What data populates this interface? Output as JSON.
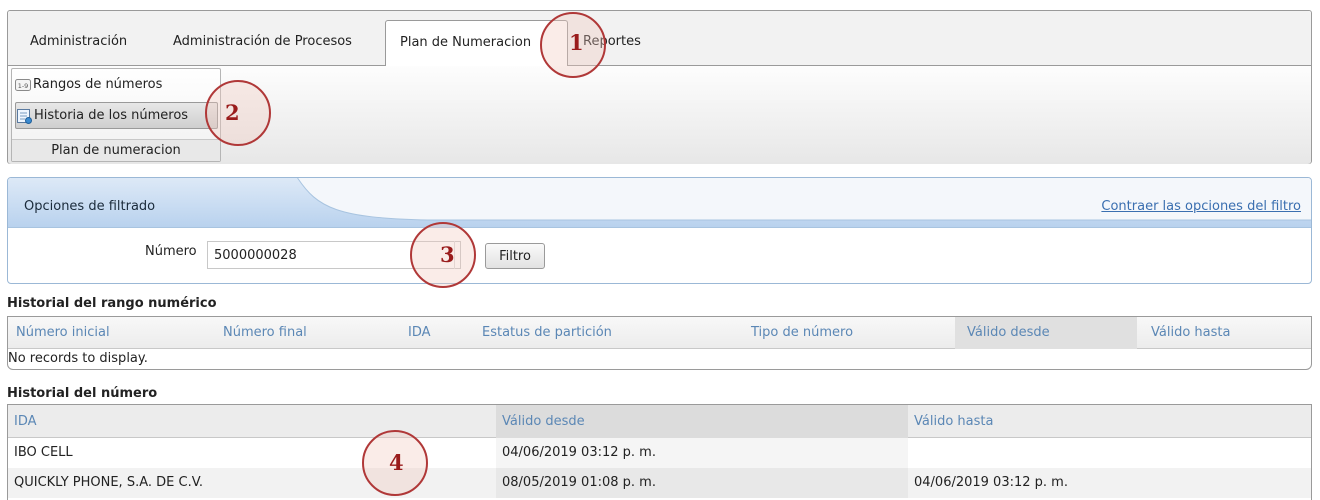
{
  "ribbon": {
    "tabs": [
      {
        "label": "Administración"
      },
      {
        "label": "Administración de Procesos"
      },
      {
        "label": "Plan de Numeracion"
      },
      {
        "label": "Reportes"
      }
    ],
    "group": {
      "buttons": [
        {
          "label": "Rangos de números",
          "icon": "number-range-icon"
        },
        {
          "label": "Historia de los números",
          "icon": "number-history-icon"
        }
      ],
      "label": "Plan de numeracion"
    }
  },
  "filter": {
    "title": "Opciones de filtrado",
    "collapse_link": "Contraer las opciones del filtro",
    "number_label": "Número",
    "number_value": "5000000028",
    "button_label": "Filtro"
  },
  "range_history": {
    "title": "Historial del rango numérico",
    "columns": [
      "Número inicial",
      "Número final",
      "IDA",
      "Estatus de partición",
      "Tipo de número",
      "Válido desde",
      "Válido hasta"
    ],
    "empty_text": "No records to display."
  },
  "number_history": {
    "title": "Historial del número",
    "columns": [
      "IDA",
      "Válido desde",
      "Válido hasta"
    ],
    "rows": [
      [
        "IBO CELL",
        "04/06/2019 03:12 p. m.",
        ""
      ],
      [
        "QUICKLY PHONE, S.A. DE C.V.",
        "08/05/2019 01:08 p. m.",
        "04/06/2019 03:12 p. m."
      ]
    ]
  },
  "annotations": [
    "1",
    "2",
    "3",
    "4"
  ],
  "colors": {
    "header_text": "#5b87b5",
    "link": "#3a6fb0",
    "filter_head": "#cfe0f4",
    "annotation": "#b03838"
  }
}
